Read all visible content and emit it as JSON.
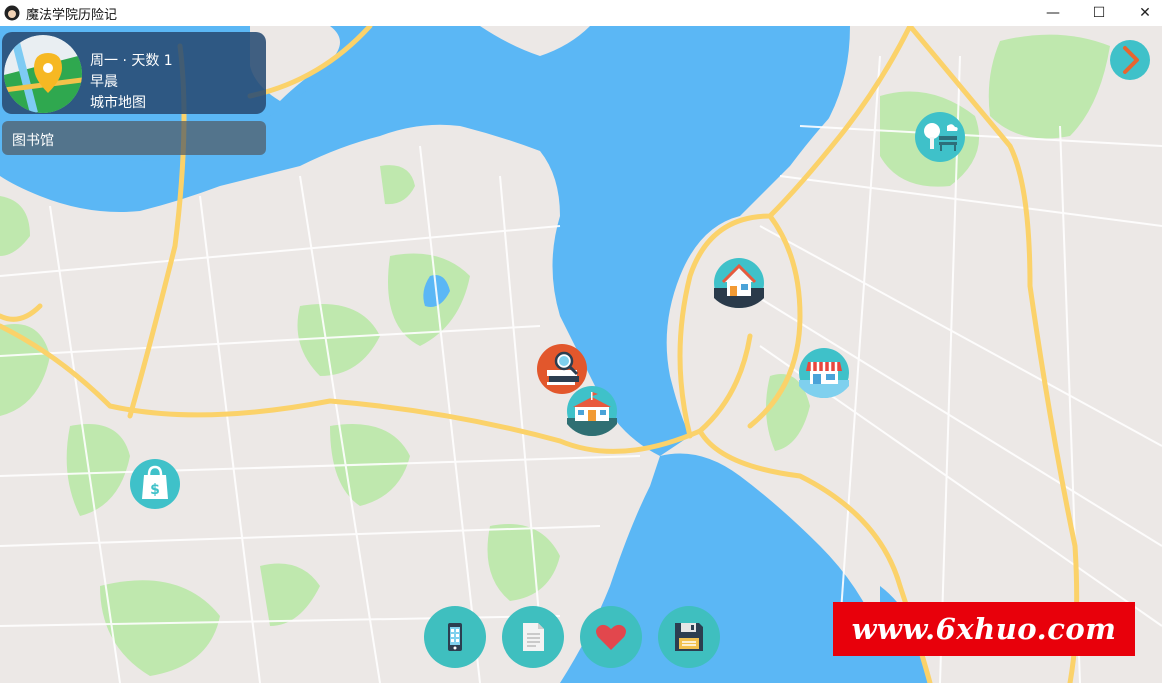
{
  "window": {
    "title": "魔法学院历险记",
    "minimize_glyph": "—",
    "maximize_glyph": "☐",
    "close_glyph": "✕"
  },
  "status": {
    "day_line": "周一 · 天数 1",
    "time_of_day": "早晨",
    "map_name": "城市地图"
  },
  "current_place": "图书馆",
  "map_markers": [
    {
      "name": "park-marker",
      "icon": "park-bench-icon"
    },
    {
      "name": "home-marker",
      "icon": "house-icon"
    },
    {
      "name": "shop-marker",
      "icon": "storefront-icon"
    },
    {
      "name": "library-marker",
      "icon": "library-reader-icon"
    },
    {
      "name": "school-marker",
      "icon": "school-building-icon"
    },
    {
      "name": "mall-marker",
      "icon": "shopping-bag-icon"
    }
  ],
  "toolbar": [
    {
      "name": "phone-button",
      "icon": "phone-icon"
    },
    {
      "name": "notes-button",
      "icon": "document-icon"
    },
    {
      "name": "favorites-button",
      "icon": "heart-icon"
    },
    {
      "name": "save-button",
      "icon": "floppy-disk-icon"
    }
  ],
  "watermark": "www.6xhuo.com",
  "colors": {
    "water": "#5bb7f5",
    "land": "#ece8e6",
    "park": "#bfe8ae",
    "highway": "#fbd26a",
    "accent_teal": "#3fc1c9",
    "watermark_bg": "#e8000b"
  }
}
